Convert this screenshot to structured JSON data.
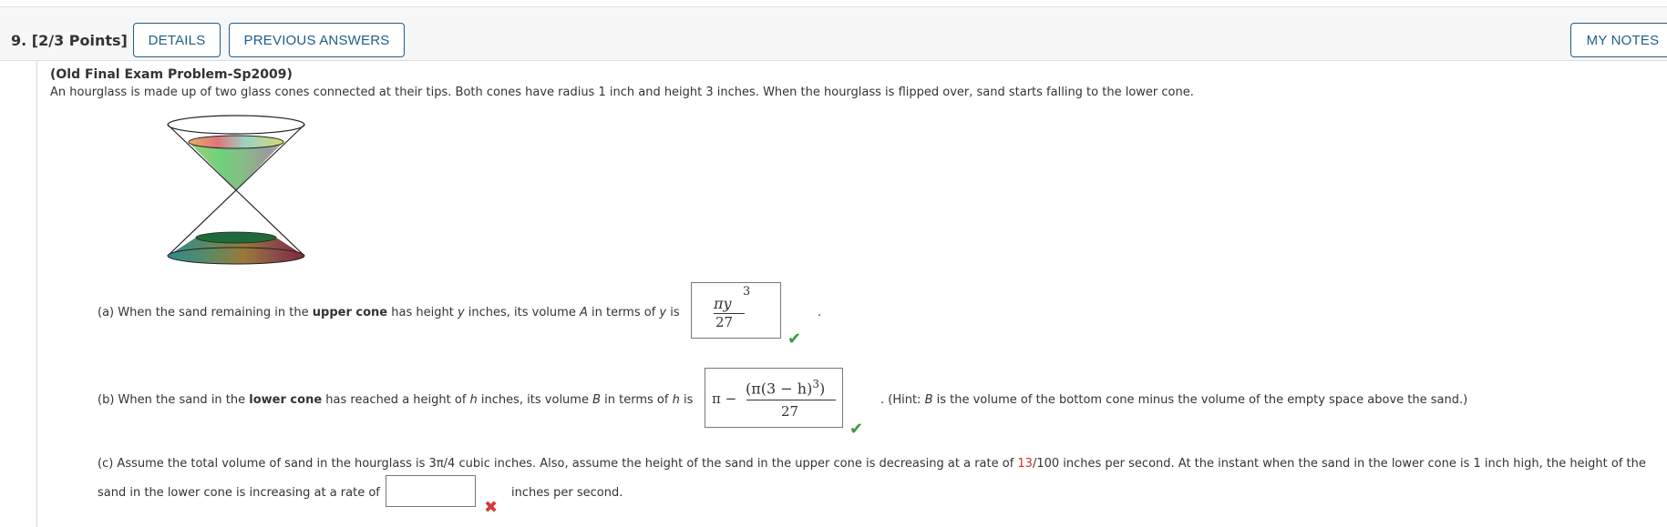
{
  "header": {
    "question_number": "9.",
    "points": "[2/3 Points]",
    "details_button": "DETAILS",
    "previous_answers_button": "PREVIOUS ANSWERS",
    "my_notes_button": "MY NOTES"
  },
  "problem": {
    "title": "(Old Final Exam Problem-Sp2009)",
    "intro": "An hourglass is made up of two glass cones connected at their tips. Both cones have radius 1 inch and height 3 inches. When the hourglass is flipped over, sand starts falling to the lower cone."
  },
  "part_a": {
    "t1": "(a) When the sand remaining in the ",
    "bold": "upper cone",
    "t2": " has height ",
    "var1": "y",
    "t3": " inches, its volume ",
    "var2": "A",
    "t4": " in terms of ",
    "var3": "y",
    "t5": " is",
    "answer_num": "πy",
    "answer_exp": "3",
    "answer_den": "27",
    "after": ".",
    "status": "correct"
  },
  "part_b": {
    "t1": "(b) When the sand in the ",
    "bold": "lower cone",
    "t2": " has reached a height of ",
    "var1": "h",
    "t3": " inches, its volume ",
    "var2": "B",
    "t4": " in terms of ",
    "var3": "h",
    "t5": " is",
    "answer_pi_minus": "π −",
    "answer_num": "(π(3 − h)",
    "answer_exp": "3",
    "answer_close": ")",
    "answer_den": "27",
    "hint_t1": ". (Hint: ",
    "hint_var": "B",
    "hint_t2": " is the volume of the bottom cone minus the volume of the empty space above the sand.)",
    "status": "correct"
  },
  "part_c": {
    "t1": "(c) Assume the total volume of sand in the hourglass is 3π/4 cubic inches. Also, assume the height of the sand in the upper cone is decreasing at a rate of ",
    "rate_num": "13",
    "t2": "/100 inches per second. At the instant when the sand in the lower cone is 1 inch high, the height of the",
    "line2": "sand in the lower cone is increasing at a rate of",
    "answer_value": "",
    "after": "inches per second.",
    "status": "incorrect"
  },
  "colors": {
    "accent": "#1f5e8c",
    "correct": "#3a9a3a",
    "incorrect": "#d43a3a",
    "highlight_number": "#d0322b"
  },
  "icons": {
    "check": "check-icon",
    "cross": "cross-icon"
  }
}
